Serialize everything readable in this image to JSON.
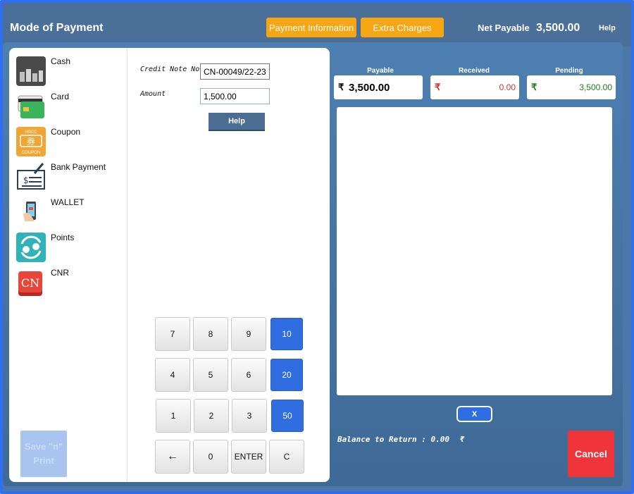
{
  "header": {
    "title": "Mode of Payment",
    "payment_info_label": "Payment Information",
    "extra_charges_label": "Extra Charges",
    "net_payable_label": "Net Payable",
    "net_payable_value": "3,500.00",
    "help_label": "Help"
  },
  "modes": [
    {
      "label": "Cash",
      "icon": "cash-icon"
    },
    {
      "label": "Card",
      "icon": "card-icon"
    },
    {
      "label": "Coupon",
      "icon": "coupon-icon"
    },
    {
      "label": "Bank Payment",
      "icon": "bank-payment-icon"
    },
    {
      "label": "WALLET",
      "icon": "wallet-icon"
    },
    {
      "label": "Points",
      "icon": "points-icon"
    },
    {
      "label": "CNR",
      "icon": "cnr-icon"
    }
  ],
  "coupon_icon_text": {
    "top": "HSCC",
    "mid": "券",
    "bottom": "COUPON"
  },
  "cnr_icon_text": "CN",
  "save_print_label": "Save \"n\" Print",
  "form": {
    "credit_note_label": "Credit Note No",
    "credit_note_value": "CN-00049/22-23",
    "amount_label": "Amount",
    "amount_value": "1,500.00",
    "help_label": "Help"
  },
  "keypad": {
    "rows": [
      [
        "7",
        "8",
        "9",
        "10"
      ],
      [
        "4",
        "5",
        "6",
        "20"
      ],
      [
        "1",
        "2",
        "3",
        "50"
      ],
      [
        "←",
        "0",
        "ENTER",
        "C"
      ]
    ]
  },
  "summary": {
    "payable_label": "Payable",
    "payable_value": "3,500.00",
    "received_label": "Received",
    "received_value": "0.00",
    "pending_label": "Pending",
    "pending_value": "3,500.00",
    "currency": "₹"
  },
  "actions": {
    "clear_label": "X",
    "balance_text": "Balance to Return : 0.00",
    "balance_currency": "₹",
    "cancel_label": "Cancel"
  },
  "colors": {
    "accent_orange": "#f7a613",
    "accent_blue": "#2f6de0",
    "cancel_red": "#f0353a",
    "received_red": "#c0392b",
    "pending_green": "#1f7a1f"
  }
}
